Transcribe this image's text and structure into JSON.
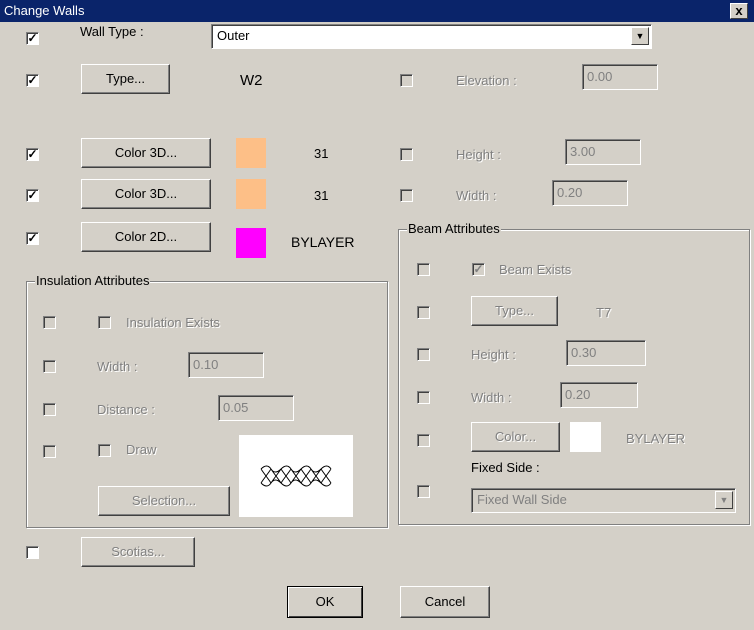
{
  "window": {
    "title": "Change Walls",
    "close_glyph": "x"
  },
  "check_glyph": "✓",
  "wall_type": {
    "label": "Wall Type :",
    "value": "Outer"
  },
  "type_row": {
    "button": "Type...",
    "value": "W2"
  },
  "color3d_row1": {
    "button": "Color 3D...",
    "value": "31",
    "swatch": "#fdbf87"
  },
  "color3d_row2": {
    "button": "Color 3D...",
    "value": "31",
    "swatch": "#fdbf87"
  },
  "color2d_row": {
    "button": "Color 2D...",
    "value": "BYLAYER",
    "swatch": "#ff00ff"
  },
  "elevation": {
    "label": "Elevation :",
    "value": "0.00"
  },
  "height": {
    "label": "Height  :",
    "value": "3.00"
  },
  "width": {
    "label": "Width :",
    "value": "0.20"
  },
  "insulation": {
    "title": "Insulation Attributes",
    "exists_label": "Insulation Exists",
    "width_label": "Width :",
    "width_value": "0.10",
    "distance_label": "Distance :",
    "distance_value": "0.05",
    "draw_label": "Draw",
    "selection_button": "Selection..."
  },
  "beam": {
    "title": "Beam Attributes",
    "exists_label": "Beam Exists",
    "type_button": "Type...",
    "type_value": "T7",
    "height_label": "Height :",
    "height_value": "0.30",
    "width_label": "Width :",
    "width_value": "0.20",
    "color_button": "Color...",
    "color_value": "BYLAYER",
    "color_swatch": "#ffffff",
    "fixed_side_label": "Fixed Side :",
    "fixed_side_value": "Fixed Wall Side"
  },
  "scotias_button": "Scotias...",
  "ok_button": "OK",
  "cancel_button": "Cancel"
}
